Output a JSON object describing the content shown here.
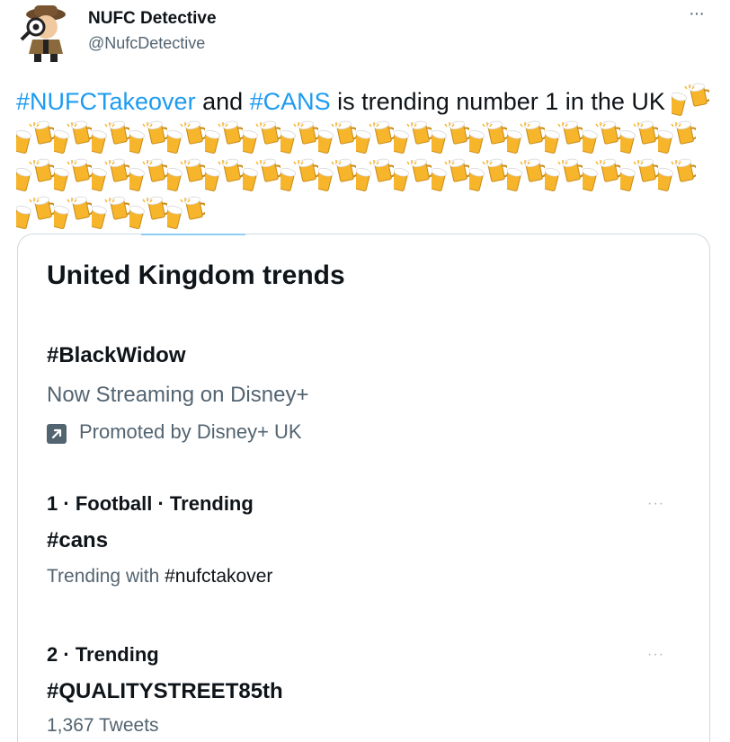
{
  "tweet": {
    "author_name": "NUFC Detective",
    "author_handle": "@NufcDetective",
    "more_label": "···",
    "text": {
      "hashtag1": "#NUFCTakeover",
      "mid1": " and ",
      "hashtag2": "#CANS",
      "mid2": " is trending number 1 in the UK ",
      "emoji_name": "beer-mug-emoji",
      "emoji_count": 42
    }
  },
  "trends_card": {
    "title": "United Kingdom trends",
    "promoted": {
      "hashtag": "#BlackWidow",
      "subtitle": "Now Streaming on Disney+",
      "promoted_by": "Promoted by Disney+ UK"
    },
    "trends": [
      {
        "rank": "1",
        "context_category": "Football",
        "context_status": "Trending",
        "hashtag": "#cans",
        "detail_prefix": "Trending with ",
        "detail_tag": "#nufctakover",
        "more_label": "···"
      },
      {
        "rank": "2",
        "context_status": "Trending",
        "hashtag": "#QUALITYSTREET85th",
        "tweets": "1,367 Tweets",
        "more_label": "···"
      }
    ]
  },
  "colors": {
    "link": "#1d9bf0",
    "secondary_text": "#536471",
    "primary_text": "#0f1419",
    "border": "#cfd9de"
  }
}
